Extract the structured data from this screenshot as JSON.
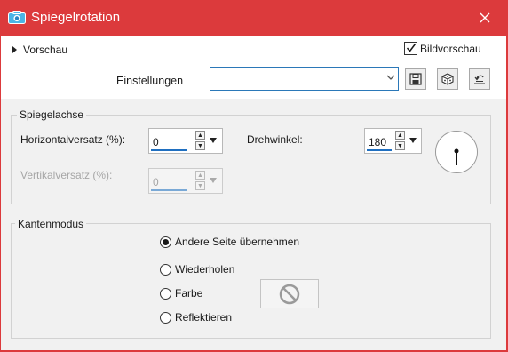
{
  "window": {
    "title": "Spiegelrotation",
    "close_icon": "close-icon",
    "app_icon": "camera-icon",
    "accent_color": "#dc3a3c"
  },
  "preview": {
    "toggle_label": "Vorschau",
    "bildvorschau_label": "Bildvorschau",
    "bildvorschau_checked": true
  },
  "settings": {
    "label": "Einstellungen",
    "value": "",
    "buttons": [
      "save-icon",
      "random-dice-icon",
      "reset-icon"
    ]
  },
  "axis_group": {
    "title": "Spiegelachse",
    "horizontal": {
      "label": "Horizontalversatz (%):",
      "value": "0"
    },
    "vertical": {
      "label": "Vertikalversatz (%):",
      "value": "0",
      "enabled": false
    },
    "angle": {
      "label": "Drehwinkel:",
      "value": "180"
    }
  },
  "edge_group": {
    "title": "Kantenmodus",
    "options": [
      {
        "label": "Andere Seite übernehmen",
        "selected": true
      },
      {
        "label": "Wiederholen",
        "selected": false
      },
      {
        "label": "Farbe",
        "selected": false
      },
      {
        "label": "Reflektieren",
        "selected": false
      }
    ],
    "color_swatch_icon": "no-color-icon"
  }
}
